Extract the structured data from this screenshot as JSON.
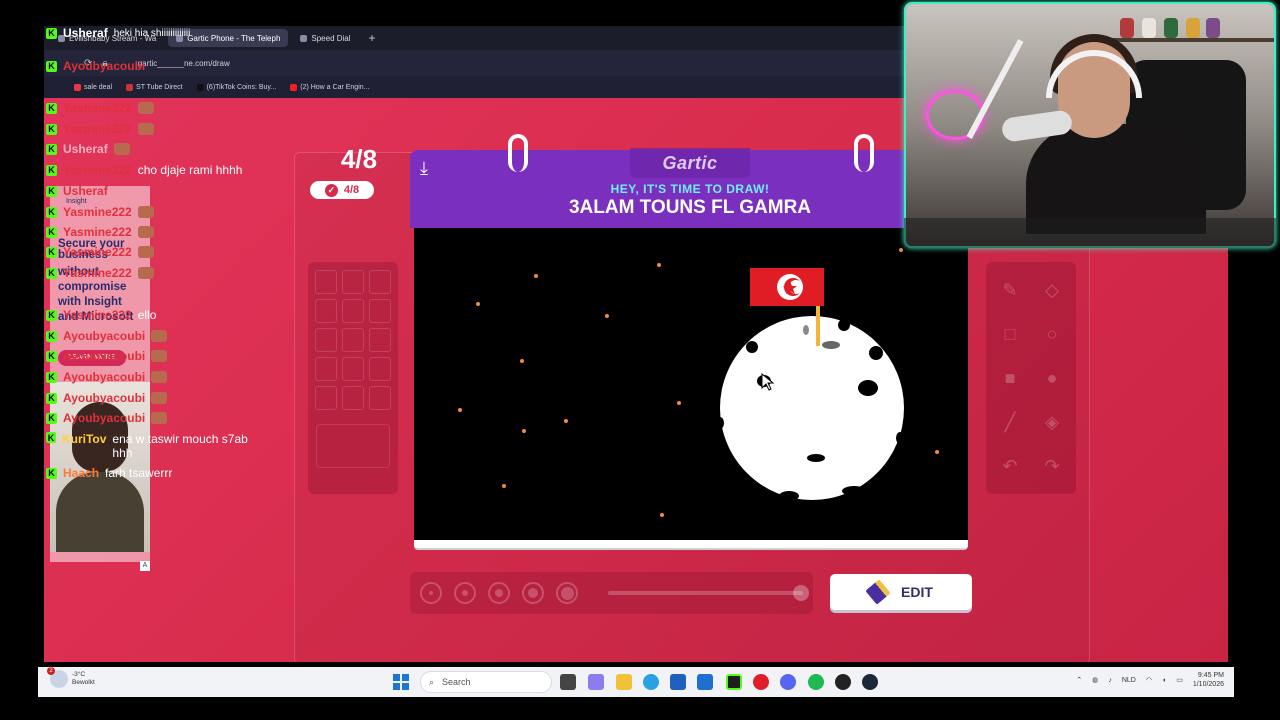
{
  "browser": {
    "tabs": [
      {
        "label": "Evilishbaby Stream - Wa",
        "active": false
      },
      {
        "label": "Gartic Phone - The Teleph",
        "active": true
      },
      {
        "label": "Speed Dial",
        "active": false
      }
    ],
    "new_tab": "+",
    "url": "gartic______ne.com/draw",
    "bookmarks": [
      {
        "label": "sale deal",
        "color": "#e34"
      },
      {
        "label": "ST Tube Direct",
        "color": "#c33"
      },
      {
        "label": "(6)TikTok Coins: Buy...",
        "color": "#111"
      },
      {
        "label": "(2) How a Car Engin...",
        "color": "#e22"
      }
    ]
  },
  "game": {
    "round": "4/8",
    "round_pill": "4/8",
    "logo": "Gartic",
    "prompt_heading": "HEY, IT'S TIME TO DRAW!",
    "prompt_text": "3ALAM TOUNS FL GAMRA",
    "edit_label": "EDIT",
    "tool_icons": [
      "pencil-icon",
      "eraser-icon",
      "square-icon",
      "circle-icon",
      "filled-square-icon",
      "filled-circle-icon",
      "line-icon",
      "fill-bucket-icon",
      "undo-icon",
      "redo-icon"
    ],
    "accent_purple": "#7b2fbf",
    "prompt_color": "#6ff0ff",
    "bg_red": "#d82a4a"
  },
  "chat": [
    {
      "user": "Usheraf",
      "user_color": "#ffffff",
      "text": "heki hia shiiiiiiiiiiiii"
    },
    {
      "user": "Ayoubyacoubi",
      "user_color": "#e0303b",
      "text": ""
    },
    {
      "user": "Yasmine222",
      "user_color": "#e0303b",
      "text": ""
    },
    {
      "user": "Yasmine222",
      "user_color": "#e0303b",
      "text": ""
    },
    {
      "user": "Usheraf",
      "user_color": "#ffb0c0",
      "text": ""
    },
    {
      "user": "Yasmine222",
      "user_color": "#e0303b",
      "text": "cho djaje rami hhhh"
    },
    {
      "user": "Usheraf",
      "user_color": "#e0303b",
      "text": ""
    },
    {
      "user": "Yasmine222",
      "user_color": "#e0303b",
      "text": ""
    },
    {
      "user": "Yasmine222",
      "user_color": "#e0303b",
      "text": ""
    },
    {
      "user": "Yasmine222",
      "user_color": "#e0303b",
      "text": ""
    },
    {
      "user": "Yasmine222",
      "user_color": "#e0303b",
      "text": ""
    },
    {
      "user": "Yasmine222",
      "user_color": "#e0303b",
      "text": "ello"
    },
    {
      "user": "Ayoubyacoubi",
      "user_color": "#e0303b",
      "text": ""
    },
    {
      "user": "Ayoubyacoubi",
      "user_color": "#e0303b",
      "text": ""
    },
    {
      "user": "Ayoubyacoubi",
      "user_color": "#e0303b",
      "text": ""
    },
    {
      "user": "Ayoubyacoubi",
      "user_color": "#e0303b",
      "text": ""
    },
    {
      "user": "Ayoubyacoubi",
      "user_color": "#e0303b",
      "text": ""
    },
    {
      "user": "KuriTov",
      "user_color": "#ffd040",
      "text": "ena w taswir mouch s7ab hhh"
    },
    {
      "user": "Haach",
      "user_color": "#ff7a3a",
      "text": "farh tsawerrr"
    }
  ],
  "ad": {
    "lines": [
      "Secure your",
      "business",
      "without",
      "compromise",
      "with Insight",
      "and Microsoft"
    ],
    "button": "LEARN MORE",
    "logo": "Insight",
    "mark": "A"
  },
  "taskbar": {
    "weather_temp": "-3°C",
    "weather_desc": "Bewolkt",
    "weather_badge": "2",
    "search_placeholder": "Search",
    "language": "NLD",
    "time": "9:45 PM",
    "date": "1/10/2026"
  }
}
